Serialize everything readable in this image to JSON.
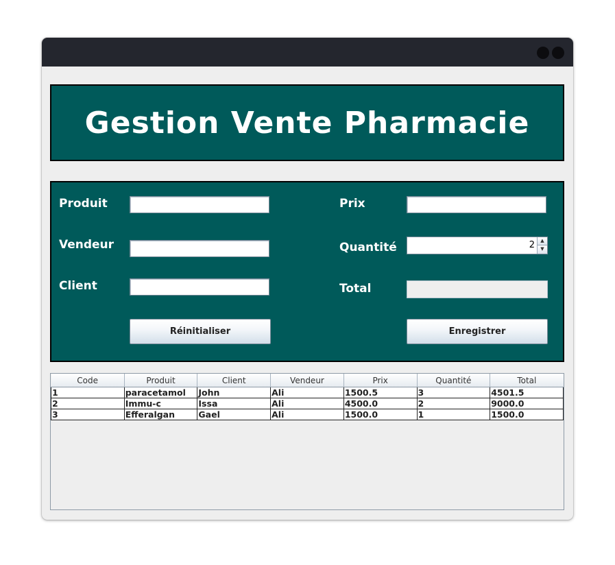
{
  "app": {
    "title": "Gestion Vente Pharmacie"
  },
  "form": {
    "produit_label": "Produit",
    "vendeur_label": "Vendeur",
    "client_label": "Client",
    "prix_label": "Prix",
    "quantite_label": "Quantité",
    "total_label": "Total",
    "produit_value": "",
    "vendeur_value": "",
    "client_value": "",
    "prix_value": "",
    "quantite_value": "2",
    "total_value": "",
    "reset_label": "Réinitialiser",
    "save_label": "Enregistrer"
  },
  "table": {
    "columns": [
      "Code",
      "Produit",
      "Client",
      "Vendeur",
      "Prix",
      "Quantité",
      "Total"
    ],
    "rows": [
      [
        "1",
        "paracetamol",
        "John",
        "Ali",
        "1500.5",
        "3",
        "4501.5"
      ],
      [
        "2",
        "Immu-c",
        "Issa",
        "Ali",
        "4500.0",
        "2",
        "9000.0"
      ],
      [
        "3",
        "Efferalgan",
        "Gael",
        "Ali",
        "1500.0",
        "1",
        "1500.0"
      ]
    ]
  },
  "colors": {
    "panel": "#005a5a",
    "titlebar": "#24262e"
  }
}
